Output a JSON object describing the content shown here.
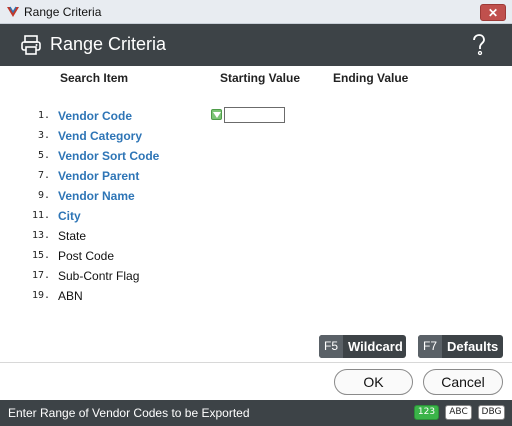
{
  "window": {
    "title": "Range Criteria"
  },
  "header": {
    "title": "Range Criteria"
  },
  "columns": {
    "search_item": "Search Item",
    "starting_value": "Starting Value",
    "ending_value": "Ending Value"
  },
  "rows": [
    {
      "num": "1.",
      "label": "Vendor Code",
      "link": true
    },
    {
      "num": "3.",
      "label": "Vend Category",
      "link": true
    },
    {
      "num": "5.",
      "label": "Vendor Sort Code",
      "link": true
    },
    {
      "num": "7.",
      "label": "Vendor Parent",
      "link": true
    },
    {
      "num": "9.",
      "label": "Vendor Name",
      "link": true
    },
    {
      "num": "11.",
      "label": "City",
      "link": true
    },
    {
      "num": "13.",
      "label": "State",
      "link": false
    },
    {
      "num": "15.",
      "label": "Post Code",
      "link": false
    },
    {
      "num": "17.",
      "label": "Sub-Contr Flag",
      "link": false
    },
    {
      "num": "19.",
      "label": "ABN",
      "link": false
    }
  ],
  "start_input": {
    "value": ""
  },
  "function_keys": {
    "wildcard": {
      "key": "F5",
      "label": "Wildcard"
    },
    "defaults": {
      "key": "F7",
      "label": "Defaults"
    }
  },
  "buttons": {
    "ok": "OK",
    "cancel": "Cancel"
  },
  "status": {
    "message": "Enter Range of Vendor Codes to be Exported",
    "badges": {
      "num": "123",
      "abc": "ABC",
      "dbg": "DBG"
    }
  },
  "colors": {
    "header_bg": "#3d4347",
    "link": "#2e75b6",
    "close": "#c0504d",
    "num_badge": "#3bb449"
  }
}
